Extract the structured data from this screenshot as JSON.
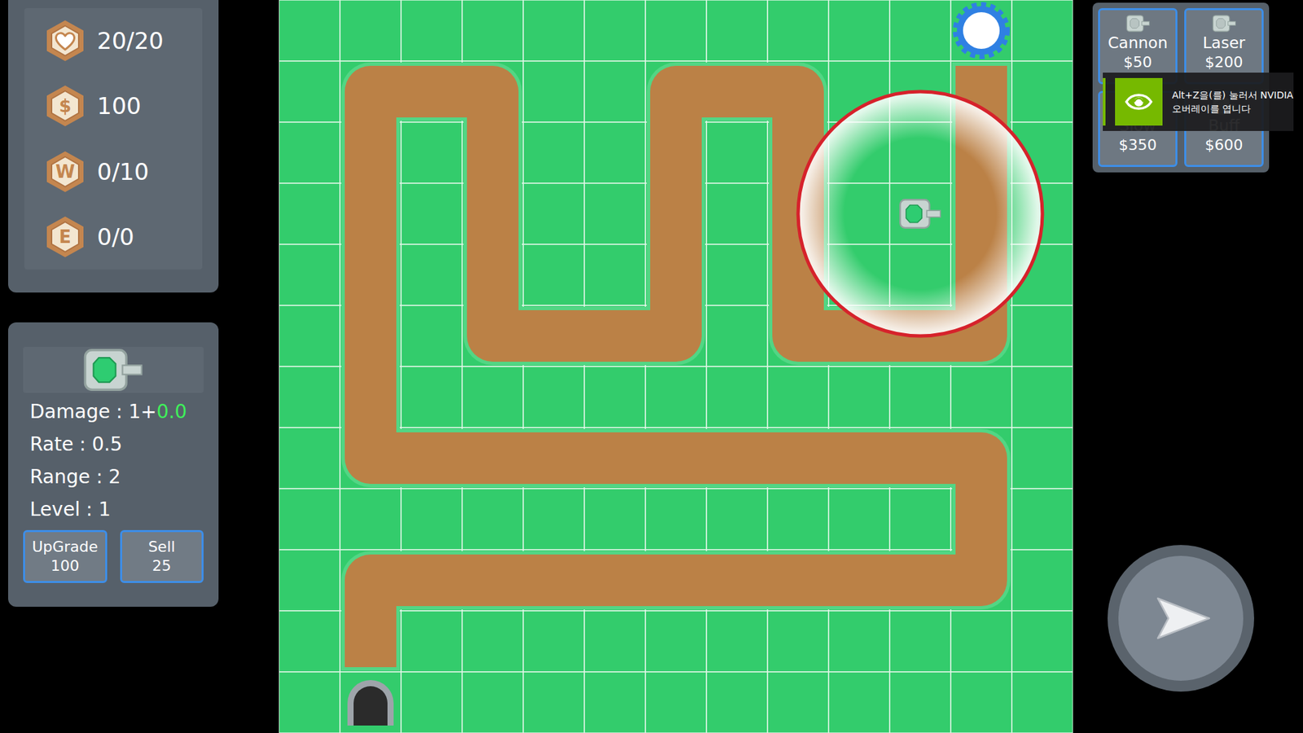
{
  "stats": [
    {
      "kind": "heart",
      "value": "20/20"
    },
    {
      "kind": "glyph",
      "glyph": "$",
      "value": "100"
    },
    {
      "kind": "glyph",
      "glyph": "W",
      "value": "0/10"
    },
    {
      "kind": "glyph",
      "glyph": "E",
      "value": "0/0"
    }
  ],
  "selected_tower": {
    "lines": [
      {
        "label": "Damage : 1+",
        "bonus": "0.0"
      },
      {
        "label": "Rate : 0.5"
      },
      {
        "label": "Range : 2"
      },
      {
        "label": "Level : 1"
      }
    ],
    "buttons": [
      {
        "label": "UpGrade",
        "value": "100"
      },
      {
        "label": "Sell",
        "value": "25"
      }
    ]
  },
  "shop": [
    {
      "name": "Cannon",
      "price": "$50"
    },
    {
      "name": "Laser",
      "price": "$200"
    },
    {
      "name": "Slow",
      "price": "$350"
    },
    {
      "name": "Buff",
      "price": "$600"
    }
  ],
  "overlay": {
    "lines": [
      "Alt+Z을(를) 눌러서 NVIDIA",
      "오버레이를 엽니다"
    ]
  },
  "map": {
    "cols": 13,
    "rows": 12,
    "path": [
      [
        11,
        1
      ],
      [
        11,
        5
      ],
      [
        8,
        5
      ],
      [
        8,
        1
      ],
      [
        6,
        1
      ],
      [
        6,
        5
      ],
      [
        3,
        5
      ],
      [
        3,
        1
      ],
      [
        1,
        1
      ],
      [
        1,
        7
      ],
      [
        11,
        7
      ],
      [
        11,
        9
      ],
      [
        1,
        9
      ],
      [
        1,
        10
      ]
    ],
    "spawn": [
      11,
      0
    ],
    "base": [
      1,
      11
    ],
    "towers": [
      {
        "col": 10,
        "row": 3,
        "selected": true,
        "range": 2
      }
    ]
  }
}
